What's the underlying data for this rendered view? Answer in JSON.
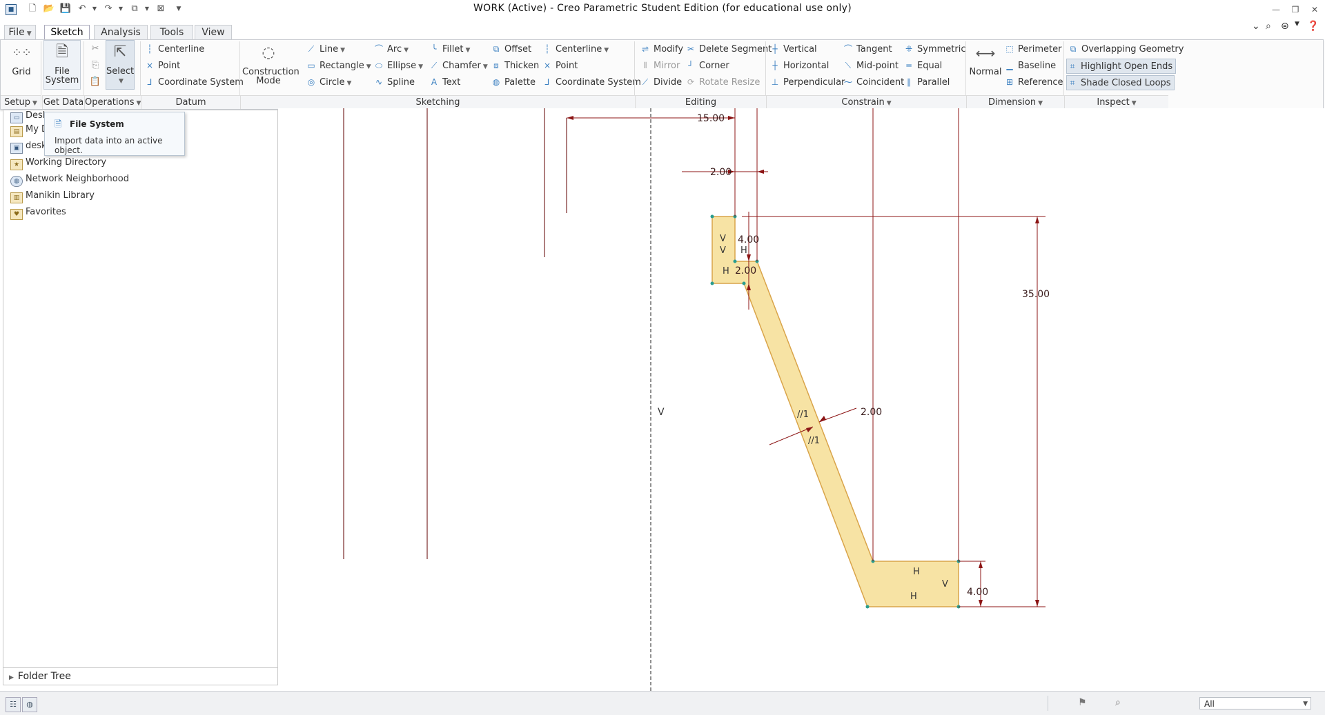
{
  "window": {
    "title": "WORK (Active) - Creo Parametric Student Edition (for educational use only)"
  },
  "tabs": [
    {
      "label": "File"
    },
    {
      "label": "Sketch"
    },
    {
      "label": "Analysis"
    },
    {
      "label": "Tools"
    },
    {
      "label": "View"
    }
  ],
  "ribbon": {
    "setup": {
      "grid": "Grid",
      "group": "Setup"
    },
    "get_data": {
      "file_system_line1": "File",
      "file_system_line2": "System",
      "group": "Get Data"
    },
    "operations": {
      "select": "Select",
      "group": "Operations"
    },
    "datum": {
      "centerline": "Centerline",
      "point": "Point",
      "coordinate_system": "Coordinate System",
      "group": "Datum"
    },
    "sketching": {
      "construction_mode_line1": "Construction",
      "construction_mode_line2": "Mode",
      "line": "Line",
      "rectangle": "Rectangle",
      "circle": "Circle",
      "arc": "Arc",
      "ellipse": "Ellipse",
      "spline": "Spline",
      "fillet": "Fillet",
      "chamfer": "Chamfer",
      "text": "Text",
      "offset": "Offset",
      "thicken": "Thicken",
      "palette": "Palette",
      "centerline": "Centerline",
      "point": "Point",
      "coordinate_system": "Coordinate System",
      "group": "Sketching"
    },
    "editing": {
      "modify": "Modify",
      "mirror": "Mirror",
      "divide": "Divide",
      "delete_segment": "Delete Segment",
      "corner": "Corner",
      "rotate_resize": "Rotate Resize",
      "group": "Editing"
    },
    "constrain": {
      "vertical": "Vertical",
      "horizontal": "Horizontal",
      "perpendicular": "Perpendicular",
      "tangent": "Tangent",
      "midpoint": "Mid-point",
      "coincident": "Coincident",
      "symmetric": "Symmetric",
      "equal": "Equal",
      "parallel": "Parallel",
      "group": "Constrain"
    },
    "dimension": {
      "normal": "Normal",
      "perimeter": "Perimeter",
      "baseline": "Baseline",
      "reference": "Reference",
      "group": "Dimension"
    },
    "inspect": {
      "overlapping": "Overlapping Geometry",
      "highlight_open_ends": "Highlight Open Ends",
      "shade_closed_loops": "Shade Closed Loops",
      "group": "Inspect"
    }
  },
  "tooltip": {
    "title": "File System",
    "text": "Import data into an active object."
  },
  "left_panel": {
    "items": [
      {
        "label": "Desk"
      },
      {
        "label": "My D"
      },
      {
        "label": "desk"
      },
      {
        "label": "Working Directory"
      },
      {
        "label": "Network Neighborhood"
      },
      {
        "label": "Manikin Library"
      },
      {
        "label": "Favorites"
      }
    ],
    "folder_tree": "Folder Tree"
  },
  "sketch": {
    "dims": {
      "top_width": "15.00",
      "small_width": "2.00",
      "step_height": "4.00",
      "step_width": "2.00",
      "total_height": "35.00",
      "thickness": "2.00",
      "bottom_height": "4.00"
    },
    "constraint_labels": {
      "vertical": "V",
      "horizontal": "H",
      "parallel": "//1"
    }
  },
  "status_bar": {
    "filter": "All"
  },
  "colors": {
    "sketch_fill": "#f7e3a4",
    "sketch_edge": "#d9a44a",
    "dimension": "#8c1515",
    "accent": "#3a7fc0"
  }
}
